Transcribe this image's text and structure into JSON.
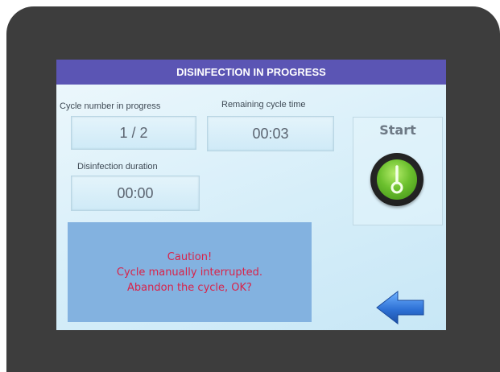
{
  "header": {
    "title": "DISINFECTION IN PROGRESS"
  },
  "cycle_number": {
    "label": "Cycle number in progress",
    "value": "1 / 2"
  },
  "remaining_time": {
    "label": "Remaining cycle time",
    "value": "00:03"
  },
  "disinfection_duration": {
    "label": "Disinfection duration",
    "value": "00:00"
  },
  "start": {
    "label": "Start",
    "icon": "power-toggle-icon"
  },
  "alert": {
    "line1": "Caution!",
    "line2": "Cycle manually interrupted.",
    "line3": "Abandon the cycle, OK?"
  },
  "back_button": {
    "icon": "arrow-left-icon"
  },
  "colors": {
    "title_bar": "#5b55b4",
    "alert_background": "#83b2e0",
    "alert_text": "#d8234a",
    "start_button": "#6cc02e",
    "back_arrow": "#2f72d6"
  }
}
